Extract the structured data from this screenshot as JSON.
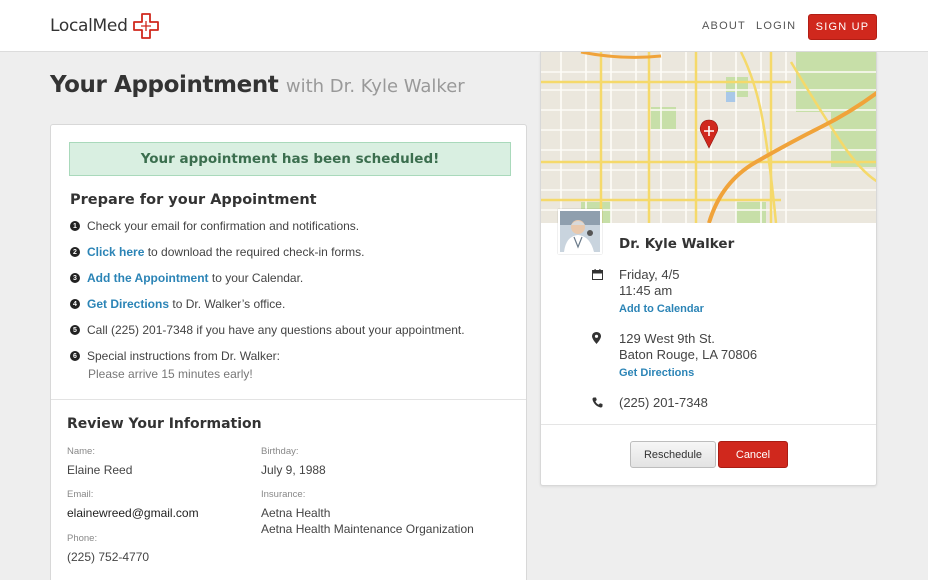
{
  "header": {
    "logo_text": "LocalMed",
    "nav": {
      "about": "ABOUT",
      "login": "LOGIN",
      "signup": "SIGN UP"
    }
  },
  "page": {
    "title": "Your Appointment",
    "subtitle": "with Dr. Kyle Walker"
  },
  "confirmation": {
    "message": "Your appointment has been scheduled!"
  },
  "prepare": {
    "title": "Prepare for your Appointment",
    "steps": [
      {
        "num": "1",
        "text": "Check your email for confirmation and notifications."
      },
      {
        "num": "2",
        "link": "Click here",
        "text": " to download the required check-in forms."
      },
      {
        "num": "3",
        "link": "Add the Appointment",
        "text": " to your Calendar."
      },
      {
        "num": "4",
        "link": "Get Directions",
        "text": " to Dr. Walker’s office."
      },
      {
        "num": "5",
        "text": "Call (225) 201-7348 if you have any questions about your appointment."
      },
      {
        "num": "6",
        "text": "Special instructions from Dr. Walker:",
        "note": "Please arrive 15 minutes early!"
      }
    ]
  },
  "review": {
    "title": "Review Your Information",
    "name": {
      "label": "Name:",
      "value": "Elaine Reed"
    },
    "birthday": {
      "label": "Birthday:",
      "value": "July 9, 1988"
    },
    "email": {
      "label": "Email:",
      "value": "elainewreed@gmail.com"
    },
    "insurance": {
      "label": "Insurance:",
      "value": "Aetna Health",
      "plan": "Aetna Health Maintenance Organization"
    },
    "phone": {
      "label": "Phone:",
      "value": "(225) 752-4770"
    }
  },
  "doctor": {
    "name": "Dr. Kyle Walker",
    "date": "Friday, 4/5",
    "time": "11:45 am",
    "add_to_calendar": "Add to Calendar",
    "address_line1": "129 West 9th St.",
    "address_line2": "Baton Rouge, LA 70806",
    "get_directions": "Get Directions",
    "phone": "(225) 201-7348",
    "reschedule": "Reschedule",
    "cancel": "Cancel"
  },
  "colors": {
    "brand_red": "#d0281d",
    "link_blue": "#2b84b6",
    "success_bg": "#d9efe1",
    "success_text": "#3b6e4e"
  }
}
